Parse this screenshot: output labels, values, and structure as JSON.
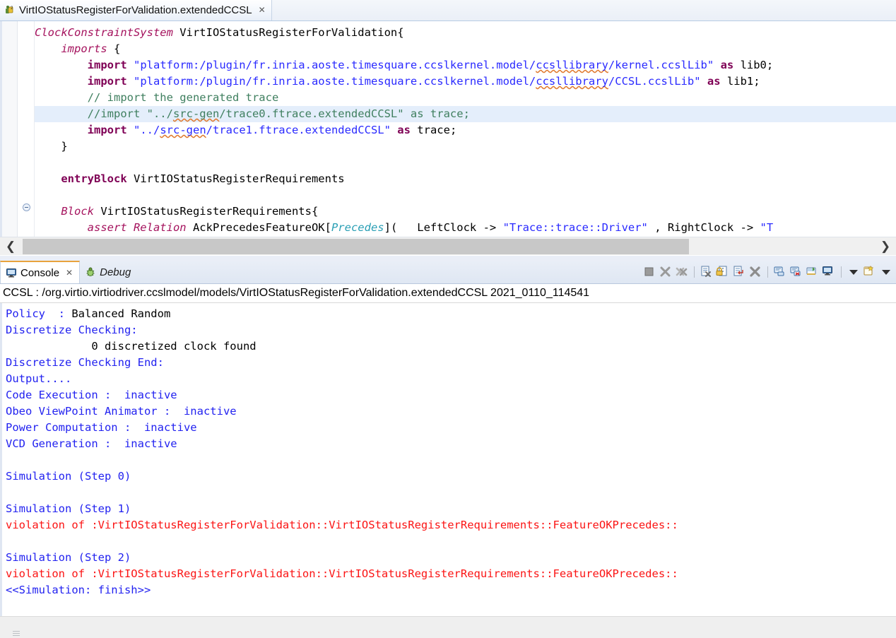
{
  "editor": {
    "tab": {
      "title": "VirtIOStatusRegisterForValidation.extendedCCSL",
      "icon": "ccsl-model-icon",
      "close": "✕"
    },
    "code_lines": [
      {
        "indent": 0,
        "segments": [
          {
            "text": "ClockConstraintSystem",
            "style": "kwi"
          },
          {
            "text": " VirtIOStatusRegisterForValidation{",
            "style": "plain"
          }
        ]
      },
      {
        "indent": 0,
        "segments": [
          {
            "text": "    ",
            "style": "plain"
          },
          {
            "text": "imports",
            "style": "kwi"
          },
          {
            "text": " {",
            "style": "plain"
          }
        ]
      },
      {
        "indent": 0,
        "segments": [
          {
            "text": "        ",
            "style": "plain"
          },
          {
            "text": "import",
            "style": "kw"
          },
          {
            "text": " ",
            "style": "plain"
          },
          {
            "text": "\"platform:/plugin/fr.inria.aoste.timesquare.ccslkernel.model/",
            "style": "str"
          },
          {
            "text": "ccsllibrary",
            "style": "str-squiggle"
          },
          {
            "text": "/kernel.ccslLib\"",
            "style": "str"
          },
          {
            "text": " ",
            "style": "plain"
          },
          {
            "text": "as",
            "style": "kw"
          },
          {
            "text": " lib0;",
            "style": "plain"
          }
        ]
      },
      {
        "indent": 0,
        "segments": [
          {
            "text": "        ",
            "style": "plain"
          },
          {
            "text": "import",
            "style": "kw"
          },
          {
            "text": " ",
            "style": "plain"
          },
          {
            "text": "\"platform:/plugin/fr.inria.aoste.timesquare.ccslkernel.model/",
            "style": "str"
          },
          {
            "text": "ccsllibrary",
            "style": "str-squiggle"
          },
          {
            "text": "/CCSL.ccslLib\"",
            "style": "str"
          },
          {
            "text": " ",
            "style": "plain"
          },
          {
            "text": "as",
            "style": "kw"
          },
          {
            "text": " lib1;",
            "style": "plain"
          }
        ]
      },
      {
        "indent": 0,
        "segments": [
          {
            "text": "        // import the generated trace",
            "style": "cmt"
          }
        ]
      },
      {
        "highlight": true,
        "segments": [
          {
            "text": "        //import \"../",
            "style": "cmt"
          },
          {
            "text": "src-gen",
            "style": "cmt-squiggle"
          },
          {
            "text": "/trace0.ftrace.extendedCCSL\" as trace;",
            "style": "cmt"
          }
        ]
      },
      {
        "indent": 0,
        "segments": [
          {
            "text": "        ",
            "style": "plain"
          },
          {
            "text": "import",
            "style": "kw"
          },
          {
            "text": " ",
            "style": "plain"
          },
          {
            "text": "\"../",
            "style": "str"
          },
          {
            "text": "src-gen",
            "style": "str-squiggle"
          },
          {
            "text": "/trace1.ftrace.extendedCCSL\"",
            "style": "str"
          },
          {
            "text": " ",
            "style": "plain"
          },
          {
            "text": "as",
            "style": "kw"
          },
          {
            "text": " trace;",
            "style": "plain"
          }
        ]
      },
      {
        "indent": 0,
        "segments": [
          {
            "text": "    }",
            "style": "plain"
          }
        ]
      },
      {
        "indent": 0,
        "segments": [
          {
            "text": "",
            "style": "plain"
          }
        ]
      },
      {
        "indent": 0,
        "segments": [
          {
            "text": "    ",
            "style": "plain"
          },
          {
            "text": "entryBlock",
            "style": "kw"
          },
          {
            "text": " VirtIOStatusRegisterRequirements",
            "style": "plain"
          }
        ]
      },
      {
        "indent": 0,
        "segments": [
          {
            "text": "",
            "style": "plain"
          }
        ]
      },
      {
        "indent": 0,
        "segments": [
          {
            "text": "    ",
            "style": "plain"
          },
          {
            "text": "Block",
            "style": "kwi"
          },
          {
            "text": " VirtIOStatusRegisterRequirements{",
            "style": "plain"
          }
        ]
      },
      {
        "indent": 0,
        "segments": [
          {
            "text": "        ",
            "style": "plain"
          },
          {
            "text": "assert Relation",
            "style": "kwi"
          },
          {
            "text": " AckPrecedesFeatureOK[",
            "style": "plain"
          },
          {
            "text": "Precedes",
            "style": "typ"
          },
          {
            "text": "](   LeftClock -> ",
            "style": "plain"
          },
          {
            "text": "\"Trace::trace::Driver\"",
            "style": "str"
          },
          {
            "text": " , RightClock -> ",
            "style": "plain"
          },
          {
            "text": "\"T",
            "style": "str"
          }
        ]
      }
    ],
    "scrollbar": {
      "left_arrow": "❮",
      "right_arrow": "❯"
    }
  },
  "console_view": {
    "tabs": [
      {
        "label": "Console",
        "icon": "console-icon",
        "active": true,
        "close": "✕"
      },
      {
        "label": "Debug",
        "icon": "debug-bug-icon",
        "active": false
      }
    ],
    "toolbar": [
      {
        "name": "terminate-button",
        "icon": "stop-square-icon"
      },
      {
        "name": "remove-launch-button",
        "icon": "remove-x-icon"
      },
      {
        "name": "remove-all-terminated-button",
        "icon": "remove-all-x-icon"
      },
      {
        "name": "clear-console-button",
        "icon": "clear-console-icon"
      },
      {
        "name": "scroll-lock-button",
        "icon": "scroll-lock-icon"
      },
      {
        "name": "word-wrap-button",
        "icon": "word-wrap-icon"
      },
      {
        "name": "close-console-button",
        "icon": "close-x-icon"
      },
      {
        "name": "pin-console-button",
        "icon": "pin-console-icon"
      },
      {
        "name": "show-console-on-output-button",
        "icon": "show-console-icon"
      },
      {
        "name": "open-console-button",
        "icon": "open-console-icon"
      },
      {
        "name": "display-selected-console-button",
        "icon": "display-console-icon"
      },
      {
        "name": "display-console-dropdown",
        "icon": "chevron-down-icon"
      },
      {
        "name": "new-console-view-button",
        "icon": "new-console-icon"
      },
      {
        "name": "new-console-dropdown",
        "icon": "chevron-down-icon"
      }
    ],
    "header": "CCSL : /org.virtio.virtiodriver.ccslmodel/models/VirtIOStatusRegisterForValidation.extendedCCSL 2021_0110_114541",
    "output_lines": [
      {
        "segments": [
          {
            "text": "Policy  : ",
            "color": "blue"
          },
          {
            "text": "Balanced Random",
            "color": "black"
          }
        ]
      },
      {
        "segments": [
          {
            "text": "Discretize Checking:",
            "color": "blue"
          }
        ]
      },
      {
        "segments": [
          {
            "text": "             0 discretized clock found",
            "color": "black"
          }
        ]
      },
      {
        "segments": [
          {
            "text": "Discretize Checking End:",
            "color": "blue"
          }
        ]
      },
      {
        "segments": [
          {
            "text": "Output....",
            "color": "blue"
          }
        ]
      },
      {
        "segments": [
          {
            "text": "Code Execution :  inactive",
            "color": "blue"
          }
        ]
      },
      {
        "segments": [
          {
            "text": "Obeo ViewPoint Animator :  inactive",
            "color": "blue"
          }
        ]
      },
      {
        "segments": [
          {
            "text": "Power Computation :  inactive",
            "color": "blue"
          }
        ]
      },
      {
        "segments": [
          {
            "text": "VCD Generation :  inactive",
            "color": "blue"
          }
        ]
      },
      {
        "segments": [
          {
            "text": "",
            "color": "blue"
          }
        ]
      },
      {
        "segments": [
          {
            "text": "Simulation (Step 0)",
            "color": "blue"
          }
        ]
      },
      {
        "segments": [
          {
            "text": "",
            "color": "blue"
          }
        ]
      },
      {
        "segments": [
          {
            "text": "Simulation (Step 1)",
            "color": "blue"
          }
        ]
      },
      {
        "segments": [
          {
            "text": "violation of :VirtIOStatusRegisterForValidation::VirtIOStatusRegisterRequirements::FeatureOKPrecedes::",
            "color": "red"
          }
        ]
      },
      {
        "segments": [
          {
            "text": "",
            "color": "blue"
          }
        ]
      },
      {
        "segments": [
          {
            "text": "Simulation (Step 2)",
            "color": "blue"
          }
        ]
      },
      {
        "segments": [
          {
            "text": "violation of :VirtIOStatusRegisterForValidation::VirtIOStatusRegisterRequirements::FeatureOKPrecedes::",
            "color": "red"
          }
        ]
      },
      {
        "segments": [
          {
            "text": "<<Simulation: finish>>",
            "color": "blue"
          }
        ]
      }
    ]
  }
}
